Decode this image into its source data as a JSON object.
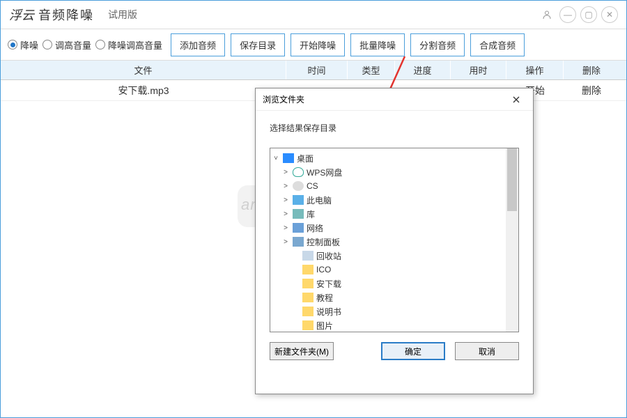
{
  "titlebar": {
    "logo": "浮云",
    "title": "音频降噪",
    "version": "试用版"
  },
  "toolbar": {
    "radios": [
      {
        "label": "降噪",
        "checked": true
      },
      {
        "label": "调高音量",
        "checked": false
      },
      {
        "label": "降噪调高音量",
        "checked": false
      }
    ],
    "buttons": {
      "add": "添加音频",
      "saveDir": "保存目录",
      "start": "开始降噪",
      "batch": "批量降噪",
      "split": "分割音频",
      "merge": "合成音频"
    }
  },
  "table": {
    "headers": {
      "file": "文件",
      "time": "时间",
      "type": "类型",
      "progress": "进度",
      "duration": "用时",
      "op": "操作",
      "del": "删除"
    },
    "rows": [
      {
        "file": "安下载.mp3",
        "time": "",
        "type": "",
        "progress": "",
        "duration": "",
        "op": "开始",
        "del": "删除"
      }
    ]
  },
  "dialog": {
    "title": "浏览文件夹",
    "subtitle": "选择结果保存目录",
    "tree": [
      {
        "label": "桌面",
        "icon": "desktop",
        "level": 1,
        "expanded": true
      },
      {
        "label": "WPS网盘",
        "icon": "cloud",
        "level": 2,
        "expandable": true
      },
      {
        "label": "CS",
        "icon": "user",
        "level": 2,
        "expandable": true
      },
      {
        "label": "此电脑",
        "icon": "pc",
        "level": 2,
        "expandable": true
      },
      {
        "label": "库",
        "icon": "lib",
        "level": 2,
        "expandable": true
      },
      {
        "label": "网络",
        "icon": "net",
        "level": 2,
        "expandable": true
      },
      {
        "label": "控制面板",
        "icon": "ctrl",
        "level": 2,
        "expandable": true
      },
      {
        "label": "回收站",
        "icon": "recycle",
        "level": 3
      },
      {
        "label": "ICO",
        "icon": "folder",
        "level": 3
      },
      {
        "label": "安下载",
        "icon": "folder",
        "level": 3
      },
      {
        "label": "教程",
        "icon": "folder",
        "level": 3
      },
      {
        "label": "说明书",
        "icon": "folder",
        "level": 3
      },
      {
        "label": "图片",
        "icon": "folder",
        "level": 3
      }
    ],
    "buttons": {
      "newFolder": "新建文件夹(M)",
      "ok": "确定",
      "cancel": "取消"
    }
  },
  "watermark": "anxz.com"
}
